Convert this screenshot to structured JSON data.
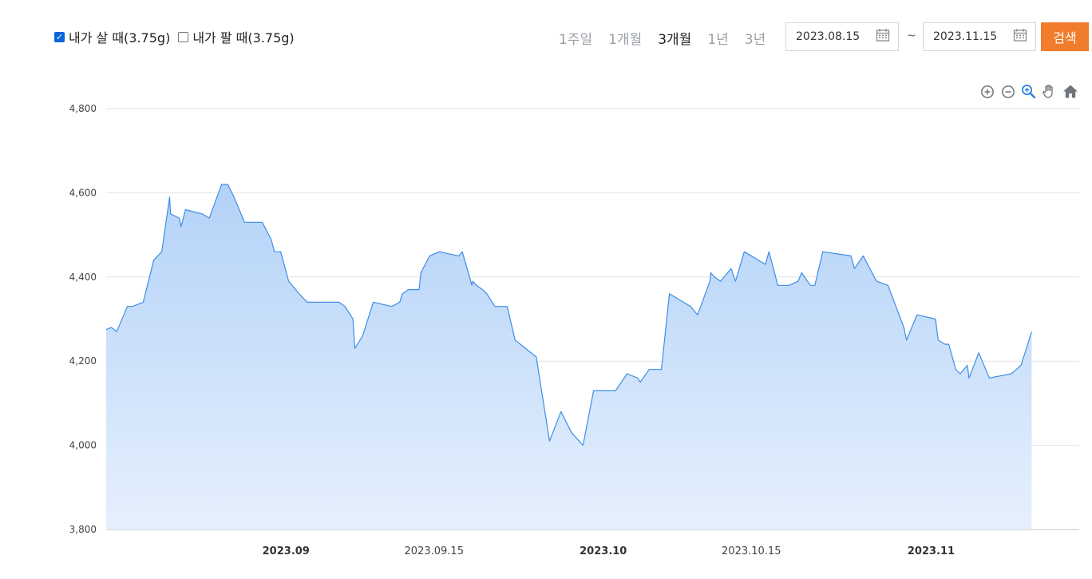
{
  "controls": {
    "buy_checkbox": {
      "label": "내가 살 때(3.75g)",
      "checked": true
    },
    "sell_checkbox": {
      "label": "내가 팔 때(3.75g)",
      "checked": false
    },
    "periods": [
      {
        "label": "1주일",
        "active": false
      },
      {
        "label": "1개월",
        "active": false
      },
      {
        "label": "3개월",
        "active": true
      },
      {
        "label": "1년",
        "active": false
      },
      {
        "label": "3년",
        "active": false
      }
    ],
    "date_from": "2023.08.15",
    "date_separator": "~",
    "date_to": "2023.11.15",
    "search_label": "검색"
  },
  "toolbar_icons": [
    "zoom-in-icon",
    "zoom-out-icon",
    "zoom-select-icon",
    "pan-hand-icon",
    "home-icon"
  ],
  "colors": {
    "accent": "#f07c2c",
    "line": "#3d8ee6",
    "fill_top": "#b3d2f8",
    "fill_bottom": "#e6f0fd",
    "grid": "#e3e3e3"
  },
  "chart_data": {
    "type": "area",
    "title": "",
    "xlabel": "",
    "ylabel": "",
    "ylim": [
      3800,
      4800
    ],
    "yticks": [
      3800,
      4000,
      4200,
      4400,
      4600,
      4800
    ],
    "ytick_labels": [
      "3,800",
      "4,000",
      "4,200",
      "4,400",
      "4,600",
      "4,800"
    ],
    "xlim": [
      "2023-08-15",
      "2023-11-15"
    ],
    "xticks": [
      {
        "date": "2023-09-01",
        "label": "2023.09",
        "major": true
      },
      {
        "date": "2023-09-15",
        "label": "2023.09.15",
        "major": false
      },
      {
        "date": "2023-10-01",
        "label": "2023.10",
        "major": true
      },
      {
        "date": "2023-10-15",
        "label": "2023.10.15",
        "major": false
      },
      {
        "date": "2023-11-01",
        "label": "2023.11",
        "major": true
      }
    ],
    "grid": true,
    "legend": "none",
    "series": [
      {
        "points": [
          [
            "2023-08-15 00:00",
            4275
          ],
          [
            "2023-08-15 12:00",
            4280
          ],
          [
            "2023-08-16 00:00",
            4270
          ],
          [
            "2023-08-17 00:00",
            4330
          ],
          [
            "2023-08-17 12:00",
            4330
          ],
          [
            "2023-08-18 12:00",
            4340
          ],
          [
            "2023-08-19 12:00",
            4440
          ],
          [
            "2023-08-20 06:00",
            4460
          ],
          [
            "2023-08-21 00:00",
            4590
          ],
          [
            "2023-08-21 02:00",
            4550
          ],
          [
            "2023-08-21 22:00",
            4540
          ],
          [
            "2023-08-22 02:00",
            4520
          ],
          [
            "2023-08-22 12:00",
            4560
          ],
          [
            "2023-08-24 02:00",
            4550
          ],
          [
            "2023-08-24 18:00",
            4540
          ],
          [
            "2023-08-25 22:00",
            4620
          ],
          [
            "2023-08-26 12:00",
            4620
          ],
          [
            "2023-08-27 02:00",
            4590
          ],
          [
            "2023-08-28 02:00",
            4530
          ],
          [
            "2023-08-29 18:00",
            4530
          ],
          [
            "2023-08-30 14:00",
            4490
          ],
          [
            "2023-08-30 22:00",
            4460
          ],
          [
            "2023-08-31 12:00",
            4460
          ],
          [
            "2023-09-01 06:00",
            4390
          ],
          [
            "2023-09-02 06:00",
            4360
          ],
          [
            "2023-09-03 00:00",
            4340
          ],
          [
            "2023-09-06 00:00",
            4340
          ],
          [
            "2023-09-06 14:00",
            4330
          ],
          [
            "2023-09-07 08:00",
            4300
          ],
          [
            "2023-09-07 12:00",
            4230
          ],
          [
            "2023-09-08 06:00",
            4260
          ],
          [
            "2023-09-09 06:00",
            4340
          ],
          [
            "2023-09-11 00:00",
            4330
          ],
          [
            "2023-09-11 18:00",
            4340
          ],
          [
            "2023-09-12 00:00",
            4360
          ],
          [
            "2023-09-12 14:00",
            4370
          ],
          [
            "2023-09-13 14:00",
            4370
          ],
          [
            "2023-09-13 18:00",
            4410
          ],
          [
            "2023-09-14 14:00",
            4450
          ],
          [
            "2023-09-15 12:00",
            4460
          ],
          [
            "2023-09-17 08:00",
            4450
          ],
          [
            "2023-09-17 16:00",
            4460
          ],
          [
            "2023-09-18 14:00",
            4380
          ],
          [
            "2023-09-18 16:00",
            4390
          ],
          [
            "2023-09-19 00:00",
            4380
          ],
          [
            "2023-09-19 14:00",
            4370
          ],
          [
            "2023-09-20 00:00",
            4360
          ],
          [
            "2023-09-20 18:00",
            4330
          ],
          [
            "2023-09-21 22:00",
            4330
          ],
          [
            "2023-09-22 16:00",
            4250
          ],
          [
            "2023-09-24 16:00",
            4210
          ],
          [
            "2023-09-25 22:00",
            4010
          ],
          [
            "2023-09-27 00:00",
            4080
          ],
          [
            "2023-09-28 00:00",
            4030
          ],
          [
            "2023-09-29 02:00",
            4000
          ],
          [
            "2023-09-30 02:00",
            4130
          ],
          [
            "2023-10-02 04:00",
            4130
          ],
          [
            "2023-10-03 06:00",
            4170
          ],
          [
            "2023-10-04 06:00",
            4160
          ],
          [
            "2023-10-04 12:00",
            4150
          ],
          [
            "2023-10-05 08:00",
            4180
          ],
          [
            "2023-10-06 12:00",
            4180
          ],
          [
            "2023-10-07 06:00",
            4360
          ],
          [
            "2023-10-09 06:00",
            4330
          ],
          [
            "2023-10-09 22:00",
            4310
          ],
          [
            "2023-10-11 02:00",
            4390
          ],
          [
            "2023-10-11 04:00",
            4410
          ],
          [
            "2023-10-11 12:00",
            4400
          ],
          [
            "2023-10-12 02:00",
            4390
          ],
          [
            "2023-10-13 02:00",
            4420
          ],
          [
            "2023-10-13 12:00",
            4390
          ],
          [
            "2023-10-14 08:00",
            4460
          ],
          [
            "2023-10-16 08:00",
            4430
          ],
          [
            "2023-10-16 16:00",
            4460
          ],
          [
            "2023-10-17 12:00",
            4380
          ],
          [
            "2023-10-18 14:00",
            4380
          ],
          [
            "2023-10-19 10:00",
            4390
          ],
          [
            "2023-10-19 18:00",
            4410
          ],
          [
            "2023-10-20 14:00",
            4380
          ],
          [
            "2023-10-21 00:00",
            4380
          ],
          [
            "2023-10-21 18:00",
            4460
          ],
          [
            "2023-10-24 10:00",
            4450
          ],
          [
            "2023-10-24 18:00",
            4420
          ],
          [
            "2023-10-25 14:00",
            4450
          ],
          [
            "2023-10-26 20:00",
            4390
          ],
          [
            "2023-10-27 22:00",
            4380
          ],
          [
            "2023-10-29 10:00",
            4280
          ],
          [
            "2023-10-29 16:00",
            4250
          ],
          [
            "2023-10-30 16:00",
            4310
          ],
          [
            "2023-11-01 10:00",
            4300
          ],
          [
            "2023-11-01 16:00",
            4250
          ],
          [
            "2023-11-02 08:00",
            4240
          ],
          [
            "2023-11-02 16:00",
            4240
          ],
          [
            "2023-11-03 08:00",
            4180
          ],
          [
            "2023-11-03 18:00",
            4170
          ],
          [
            "2023-11-04 10:00",
            4190
          ],
          [
            "2023-11-04 14:00",
            4160
          ],
          [
            "2023-11-05 12:00",
            4220
          ],
          [
            "2023-11-06 12:00",
            4160
          ],
          [
            "2023-11-08 14:00",
            4170
          ],
          [
            "2023-11-09 12:00",
            4190
          ],
          [
            "2023-11-10 12:00",
            4270
          ]
        ]
      }
    ]
  }
}
